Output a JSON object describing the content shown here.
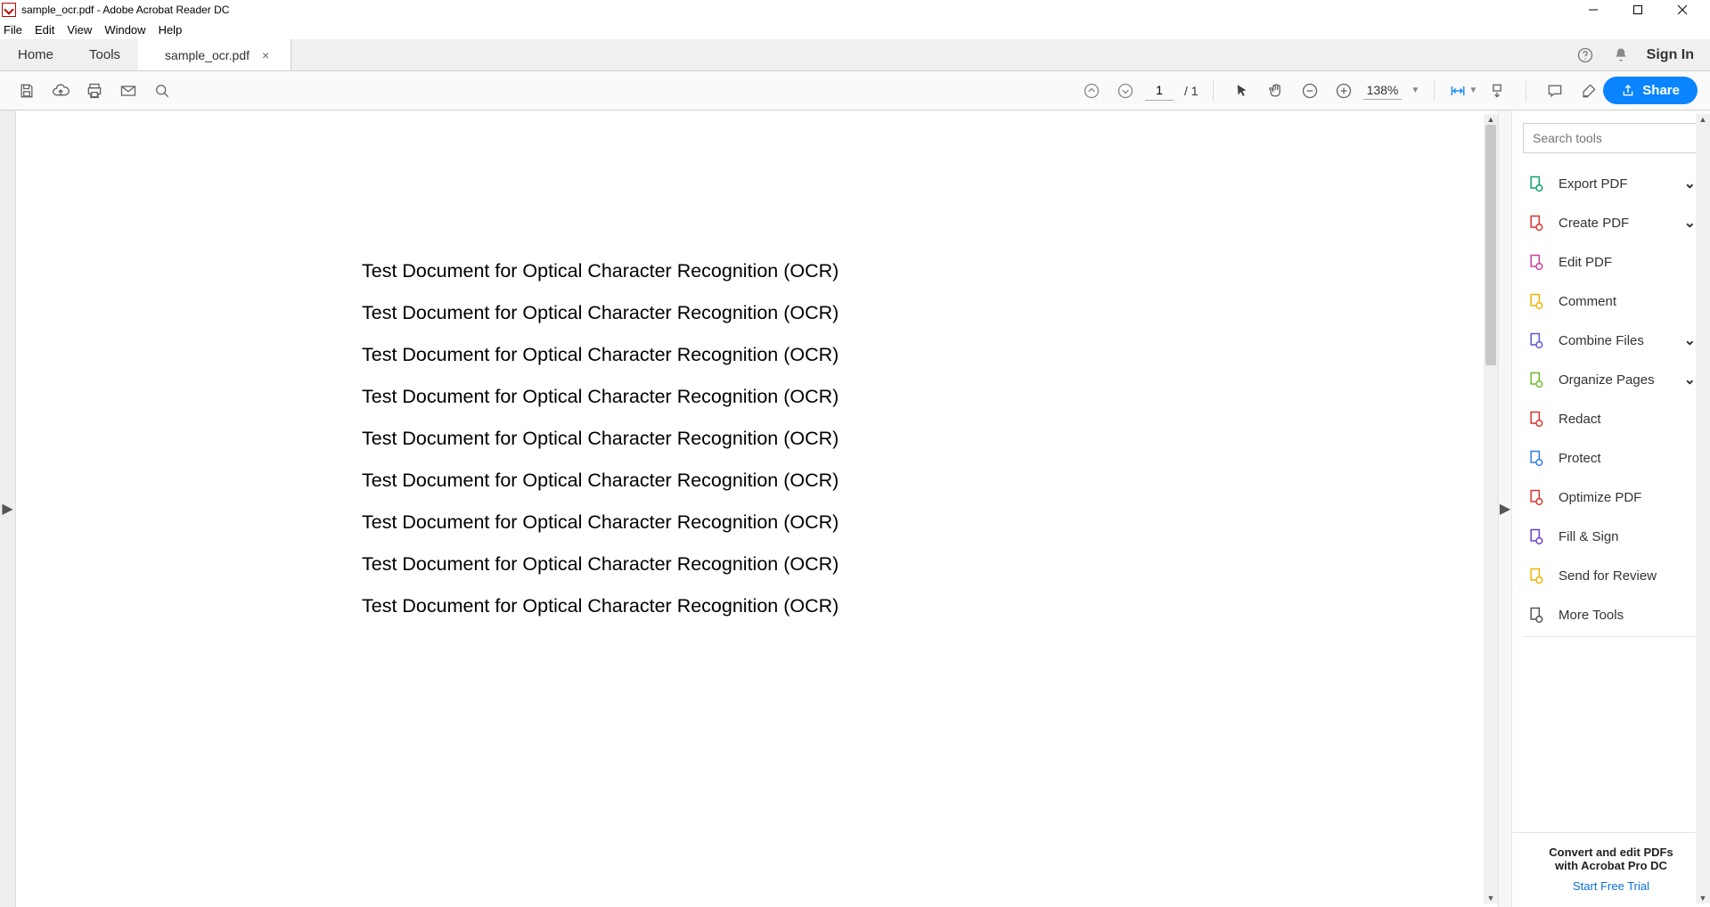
{
  "window": {
    "title": "sample_ocr.pdf - Adobe Acrobat Reader DC"
  },
  "menu": {
    "file": "File",
    "edit": "Edit",
    "view": "View",
    "window": "Window",
    "help": "Help"
  },
  "tabs": {
    "home": "Home",
    "tools": "Tools",
    "doc": "sample_ocr.pdf"
  },
  "header": {
    "signin": "Sign In"
  },
  "toolbar": {
    "page_current": "1",
    "page_total": "/  1",
    "zoom": "138%",
    "share": "Share"
  },
  "document": {
    "lines": [
      "Test Document for Optical Character Recognition (OCR)",
      "Test Document for Optical Character Recognition (OCR)",
      "Test Document for Optical Character Recognition (OCR)",
      "Test Document for Optical Character Recognition (OCR)",
      "Test Document for Optical Character Recognition (OCR)",
      "Test Document for Optical Character Recognition (OCR)",
      "Test Document for Optical Character Recognition (OCR)",
      "Test Document for Optical Character Recognition (OCR)",
      "Test Document for Optical Character Recognition (OCR)"
    ]
  },
  "rightPanel": {
    "search_placeholder": "Search tools",
    "tools": [
      {
        "label": "Export PDF",
        "chev": true,
        "color": "#0aa36f"
      },
      {
        "label": "Create PDF",
        "chev": true,
        "color": "#d9342b"
      },
      {
        "label": "Edit PDF",
        "chev": false,
        "color": "#d13da0"
      },
      {
        "label": "Comment",
        "chev": false,
        "color": "#efb100"
      },
      {
        "label": "Combine Files",
        "chev": true,
        "color": "#5b57d6"
      },
      {
        "label": "Organize Pages",
        "chev": true,
        "color": "#6fb92c"
      },
      {
        "label": "Redact",
        "chev": false,
        "color": "#d9342b"
      },
      {
        "label": "Protect",
        "chev": false,
        "color": "#2f7de1"
      },
      {
        "label": "Optimize PDF",
        "chev": false,
        "color": "#d9342b"
      },
      {
        "label": "Fill & Sign",
        "chev": false,
        "color": "#6a3fd1"
      },
      {
        "label": "Send for Review",
        "chev": false,
        "color": "#efb100"
      },
      {
        "label": "More Tools",
        "chev": false,
        "color": "#555"
      }
    ],
    "footer_line1": "Convert and edit PDFs",
    "footer_line2": "with Acrobat Pro DC",
    "footer_cta": "Start Free Trial"
  }
}
